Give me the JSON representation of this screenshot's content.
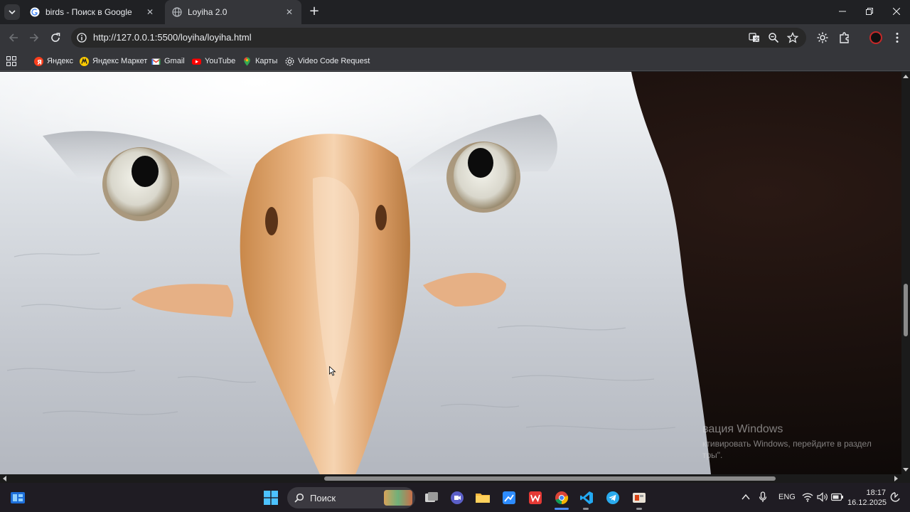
{
  "browser": {
    "tabs": [
      {
        "title": "birds - Поиск в Google",
        "favicon": "google-icon",
        "active": false
      },
      {
        "title": "Loyiha 2.0",
        "favicon": "globe-icon",
        "active": true
      }
    ],
    "address_bar": {
      "url": "http://127.0.0.1:5500/loyiha/loyiha.html"
    },
    "bookmarks": [
      {
        "label": "Яндекс",
        "icon": "yandex-icon"
      },
      {
        "label": "Яндекс Маркет",
        "icon": "yandex-market-icon"
      },
      {
        "label": "Gmail",
        "icon": "gmail-icon"
      },
      {
        "label": "YouTube",
        "icon": "youtube-icon"
      },
      {
        "label": "Карты",
        "icon": "maps-pin-icon"
      },
      {
        "label": "Video Code Request",
        "icon": "gear-icon"
      }
    ]
  },
  "page": {
    "image_subject": "bald-eagle-closeup",
    "vertical_scroll_fraction": 0.53,
    "horizontal_scroll_fraction": 0.57
  },
  "windows_watermark": {
    "line1": "вация Windows",
    "line2": "ктивировать Windows, перейдите в раздел",
    "line3": "тры\"."
  },
  "taskbar": {
    "search_label": "Поиск",
    "language": "ENG",
    "time": "18:17",
    "date": "16.12.2025"
  },
  "colors": {
    "accent": "#4c8bf5",
    "tab_bg": "#35363a",
    "frame_bg": "#202124"
  }
}
